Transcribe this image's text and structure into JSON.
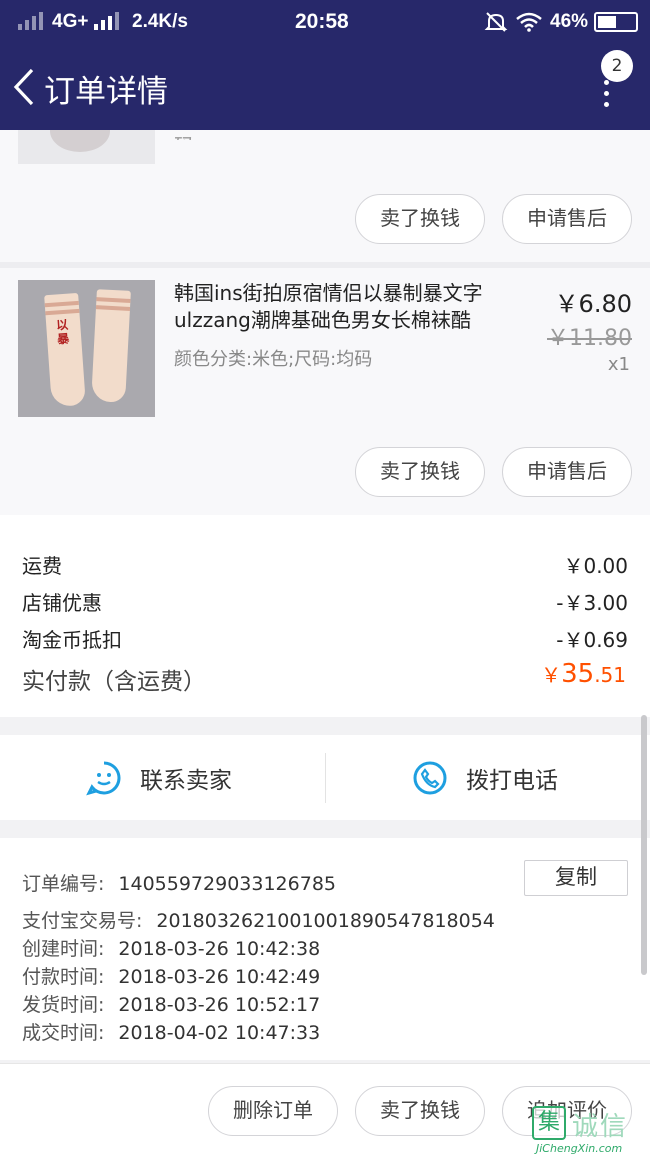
{
  "status_bar": {
    "network": "4G+",
    "speed": "2.4K/s",
    "time": "20:58",
    "battery": "46%"
  },
  "header": {
    "title": "订单详情",
    "badge_count": "2"
  },
  "product_prev": {
    "cut_text": "码",
    "buttons": [
      "卖了换钱",
      "申请售后"
    ]
  },
  "product": {
    "title": "韩国ins街拍原宿情侣以暴制暴文字ulzzang潮牌基础色男女长棉袜酷",
    "spec": "颜色分类:米色;尺码:均码",
    "price": "￥6.80",
    "original_price": "￥11.80",
    "quantity": "x1",
    "buttons": [
      "卖了换钱",
      "申请售后"
    ],
    "image_text": "以暴"
  },
  "fees": {
    "shipping_label": "运费",
    "shipping_value": "￥0.00",
    "shop_discount_label": "店铺优惠",
    "shop_discount_value": "-￥3.00",
    "coin_label": "淘金币抵扣",
    "coin_value": "-￥0.69",
    "total_label": "实付款（含运费）",
    "total_symbol": "￥",
    "total_int": "35",
    "total_dec": ".51"
  },
  "contact": {
    "seller": "联系卖家",
    "phone": "拨打电话"
  },
  "order_info": {
    "copy": "复制",
    "rows": [
      {
        "k": "订单编号:",
        "v": "140559729033126785"
      },
      {
        "k": "支付宝交易号:",
        "v": "2018032621001001890547818054"
      },
      {
        "k": "创建时间:",
        "v": "2018-03-26 10:42:38"
      },
      {
        "k": "付款时间:",
        "v": "2018-03-26 10:42:49"
      },
      {
        "k": "发货时间:",
        "v": "2018-03-26 10:52:17"
      },
      {
        "k": "成交时间:",
        "v": "2018-04-02 10:47:33"
      }
    ]
  },
  "bottom_actions": [
    "删除订单",
    "卖了换钱",
    "追加评价"
  ],
  "watermark": {
    "box": "集",
    "cn": "诚信",
    "en": "JiChengXin.com"
  },
  "colors": {
    "header_bg": "#27286a",
    "accent_orange": "#ff5000",
    "icon_blue": "#1e9fe0"
  }
}
